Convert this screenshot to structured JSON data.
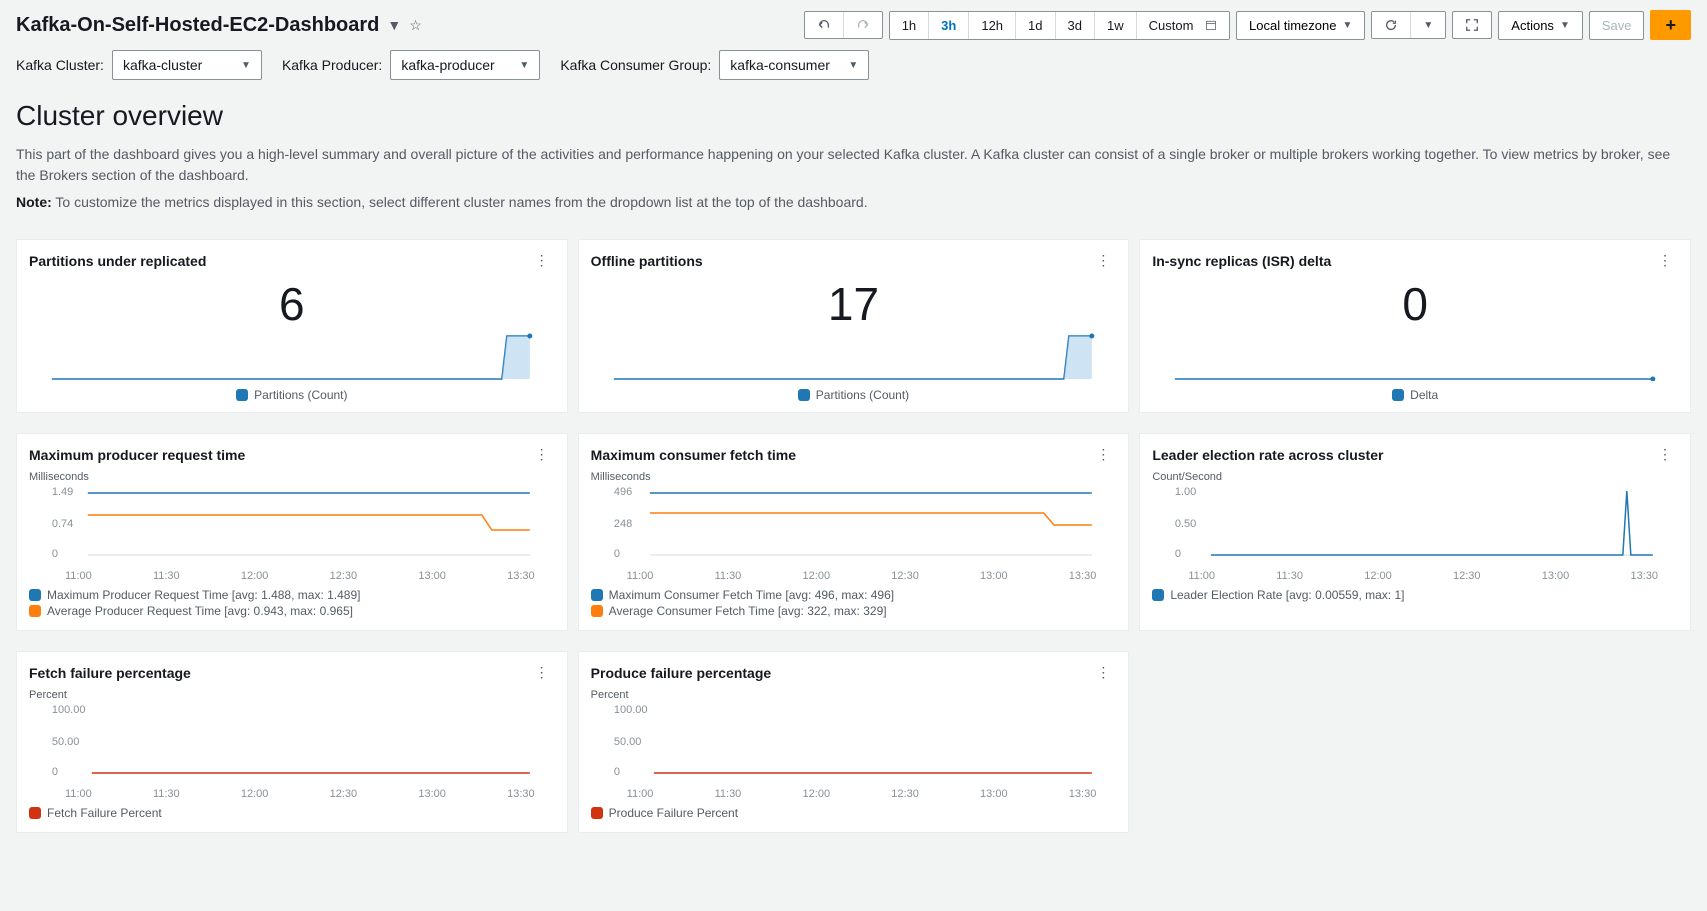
{
  "header": {
    "title": "Kafka-On-Self-Hosted-EC2-Dashboard",
    "time_ranges": [
      "1h",
      "3h",
      "12h",
      "1d",
      "3d",
      "1w",
      "Custom"
    ],
    "active_range": "3h",
    "timezone": "Local timezone",
    "actions_label": "Actions",
    "save_label": "Save"
  },
  "filters": {
    "cluster_label": "Kafka Cluster:",
    "cluster_value": "kafka-cluster",
    "producer_label": "Kafka Producer:",
    "producer_value": "kafka-producer",
    "consumer_label": "Kafka Consumer Group:",
    "consumer_value": "kafka-consumer"
  },
  "section": {
    "heading": "Cluster overview",
    "desc": "This part of the dashboard gives you a high-level summary and overall picture of the activities and performance happening on your selected Kafka cluster. A Kafka cluster can consist of a single broker or multiple brokers working together. To view metrics by broker, see the Brokers section of the dashboard.",
    "note_label": "Note:",
    "note": "To customize the metrics displayed in this section, select different cluster names from the dropdown list at the top of the dashboard."
  },
  "widgets": {
    "partitions_under": {
      "title": "Partitions under replicated",
      "value": "6",
      "legend": "Partitions (Count)"
    },
    "offline_partitions": {
      "title": "Offline partitions",
      "value": "17",
      "legend": "Partitions (Count)"
    },
    "isr_delta": {
      "title": "In-sync replicas (ISR) delta",
      "value": "0",
      "legend": "Delta"
    },
    "producer_time": {
      "title": "Maximum producer request time",
      "unit": "Milliseconds",
      "y_ticks": [
        "1.49",
        "0.74",
        "0"
      ],
      "series1": "Maximum Producer Request Time [avg: 1.488, max: 1.489]",
      "series2": "Average Producer Request Time [avg: 0.943, max: 0.965]"
    },
    "consumer_time": {
      "title": "Maximum consumer fetch time",
      "unit": "Milliseconds",
      "y_ticks": [
        "496",
        "248",
        "0"
      ],
      "series1": "Maximum Consumer Fetch Time [avg: 496, max: 496]",
      "series2": "Average Consumer Fetch Time [avg: 322, max: 329]"
    },
    "leader_election": {
      "title": "Leader election rate across cluster",
      "unit": "Count/Second",
      "y_ticks": [
        "1.00",
        "0.50",
        "0"
      ],
      "series1": "Leader Election Rate [avg: 0.00559, max: 1]"
    },
    "fetch_fail": {
      "title": "Fetch failure percentage",
      "unit": "Percent",
      "y_ticks": [
        "100.00",
        "50.00",
        "0"
      ],
      "series1": "Fetch Failure Percent"
    },
    "produce_fail": {
      "title": "Produce failure percentage",
      "unit": "Percent",
      "y_ticks": [
        "100.00",
        "50.00",
        "0"
      ],
      "series1": "Produce Failure Percent"
    }
  },
  "xticks": [
    "11:00",
    "11:30",
    "12:00",
    "12:30",
    "13:00",
    "13:30"
  ],
  "colors": {
    "blue": "#1f77b4",
    "orange": "#ff7f0e",
    "red": "#d13212",
    "lightblue": "#9ec8e8"
  },
  "chart_data": [
    {
      "type": "area",
      "title": "Partitions under replicated",
      "ylabel": "Partitions (Count)",
      "x_range": [
        "10:45",
        "13:45"
      ],
      "series": [
        {
          "name": "Partitions (Count)",
          "values_summary": "0 until ~13:40 then step to 6"
        }
      ]
    },
    {
      "type": "area",
      "title": "Offline partitions",
      "ylabel": "Partitions (Count)",
      "x_range": [
        "10:45",
        "13:45"
      ],
      "series": [
        {
          "name": "Partitions (Count)",
          "values_summary": "0 until ~13:40 then step to 17"
        }
      ]
    },
    {
      "type": "line",
      "title": "In-sync replicas (ISR) delta",
      "ylabel": "Delta",
      "x_range": [
        "10:45",
        "13:45"
      ],
      "series": [
        {
          "name": "Delta",
          "values_summary": "constant 0"
        }
      ]
    },
    {
      "type": "line",
      "title": "Maximum producer request time",
      "ylabel": "Milliseconds",
      "ylim": [
        0,
        1.49
      ],
      "x": [
        "11:00",
        "11:30",
        "12:00",
        "12:30",
        "13:00",
        "13:30"
      ],
      "series": [
        {
          "name": "Maximum Producer Request Time",
          "avg": 1.488,
          "max": 1.489,
          "values": [
            1.49,
            1.49,
            1.49,
            1.49,
            1.49,
            1.49
          ]
        },
        {
          "name": "Average Producer Request Time",
          "avg": 0.943,
          "max": 0.965,
          "values": [
            0.95,
            0.95,
            0.95,
            0.95,
            0.95,
            0.74
          ]
        }
      ]
    },
    {
      "type": "line",
      "title": "Maximum consumer fetch time",
      "ylabel": "Milliseconds",
      "ylim": [
        0,
        496
      ],
      "x": [
        "11:00",
        "11:30",
        "12:00",
        "12:30",
        "13:00",
        "13:30"
      ],
      "series": [
        {
          "name": "Maximum Consumer Fetch Time",
          "avg": 496,
          "max": 496,
          "values": [
            496,
            496,
            496,
            496,
            496,
            496
          ]
        },
        {
          "name": "Average Consumer Fetch Time",
          "avg": 322,
          "max": 329,
          "values": [
            325,
            325,
            325,
            325,
            325,
            260
          ]
        }
      ]
    },
    {
      "type": "line",
      "title": "Leader election rate across cluster",
      "ylabel": "Count/Second",
      "ylim": [
        0,
        1.0
      ],
      "x": [
        "11:00",
        "11:30",
        "12:00",
        "12:30",
        "13:00",
        "13:30",
        "13:40"
      ],
      "series": [
        {
          "name": "Leader Election Rate",
          "avg": 0.00559,
          "max": 1,
          "values": [
            0,
            0,
            0,
            0,
            0,
            0,
            1
          ]
        }
      ]
    },
    {
      "type": "line",
      "title": "Fetch failure percentage",
      "ylabel": "Percent",
      "ylim": [
        0,
        100
      ],
      "x": [
        "11:00",
        "11:30",
        "12:00",
        "12:30",
        "13:00",
        "13:30"
      ],
      "series": [
        {
          "name": "Fetch Failure Percent",
          "values": [
            0,
            0,
            0,
            0,
            0,
            0
          ]
        }
      ]
    },
    {
      "type": "line",
      "title": "Produce failure percentage",
      "ylabel": "Percent",
      "ylim": [
        0,
        100
      ],
      "x": [
        "11:00",
        "11:30",
        "12:00",
        "12:30",
        "13:00",
        "13:30"
      ],
      "series": [
        {
          "name": "Produce Failure Percent",
          "values": [
            0,
            0,
            0,
            0,
            0,
            0
          ]
        }
      ]
    }
  ]
}
